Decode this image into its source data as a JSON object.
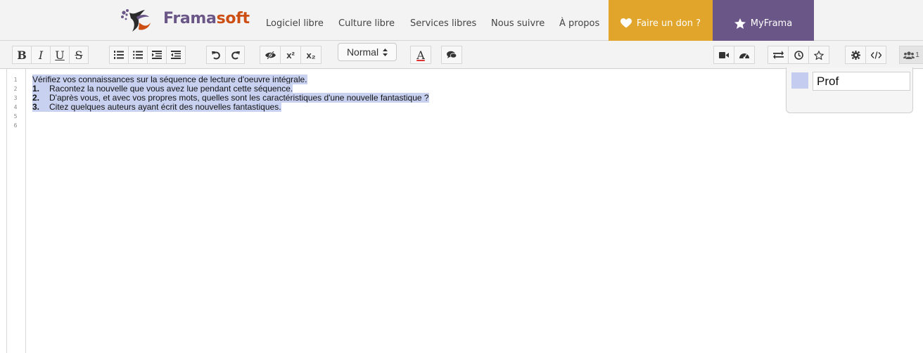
{
  "navbar": {
    "brand": {
      "part1": "Frama",
      "part2": "soft"
    },
    "links": [
      {
        "label": "Logiciel libre"
      },
      {
        "label": "Culture libre"
      },
      {
        "label": "Services libres"
      },
      {
        "label": "Nous suivre"
      },
      {
        "label": "À propos"
      }
    ],
    "donate_label": "Faire un don ?",
    "myframa_label": "MyFrama",
    "colors": {
      "violet": "#6a5687",
      "orange": "#cc4e13",
      "donate": "#e2a52b"
    }
  },
  "toolbar": {
    "bold_label": "B",
    "italic_label": "I",
    "underline_label": "U",
    "strike_label": "S",
    "superscript_label": "x²",
    "subscript_label": "x₂",
    "heading_select": "Normal",
    "text_color_label": "A",
    "users_count": "1"
  },
  "editor": {
    "line_numbers": [
      "1",
      "2",
      "3",
      "4",
      "5",
      "6"
    ],
    "lines": [
      {
        "num": "",
        "text": "Vérifiez vos connaissances sur la séquence de lecture d'oeuvre intégrale."
      },
      {
        "num": "1.",
        "text": "Racontez la nouvelle que vous avez lue pendant cette séquence."
      },
      {
        "num": "2.",
        "text": "D'après vous, et avec vos propres mots, quelles sont les caractéristiques d'une nouvelle fantastique ?"
      },
      {
        "num": "3.",
        "text": "Citez quelques auteurs ayant écrit des nouvelles fantastiques."
      }
    ],
    "highlight_color": "#c8d1f0"
  },
  "users_popup": {
    "user_name": "Prof",
    "user_color": "#c4cdef"
  }
}
